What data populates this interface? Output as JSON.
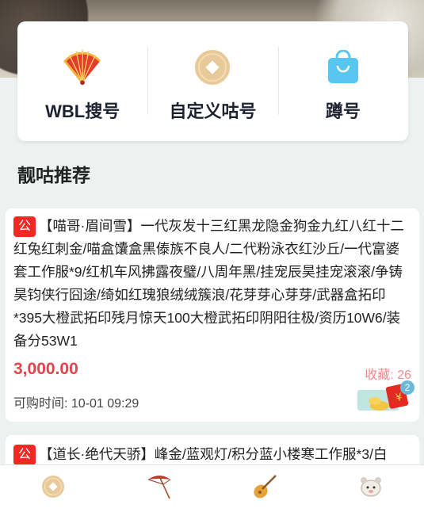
{
  "quick_actions": [
    {
      "label": "WBL搜号",
      "icon": "fan-icon"
    },
    {
      "label": "自定义咕号",
      "icon": "coin-icon"
    },
    {
      "label": "蹲号",
      "icon": "shopping-bag-icon"
    }
  ],
  "section_title": "靓咕推荐",
  "listings": [
    {
      "badge": "公",
      "description": "【喵哥·眉间雪】一代灰发十三红黑龙隐金狗金九红八红十二红兔红刺金/喵盒馕盒黑傣族不良人/二代粉泳衣红沙丘/一代富婆套工作服*9/红机车风拂露夜璧/八周年黑/挂宠辰昊挂宠滚滚/争铸昊钧侠行囧途/绮如红瑰狼绒绒簇浪/花芽芽心芽芽/武器盒拓印*395大橙武拓印残月惊天100大橙武拓印阴阳往极/资历10W6/装备分53W1",
      "price": "3,000.00",
      "favorites_label": "收藏: ",
      "favorites_count": "26",
      "available_label": "可购时间: ",
      "available_time": "10-01 09:29",
      "promo_badge": "2"
    },
    {
      "badge": "公",
      "description": "【道长·绝代天骄】峰金/蓝观灯/积分蓝小楼寒工作服*3/白"
    }
  ],
  "tabbar": [
    {
      "icon": "coin-icon"
    },
    {
      "icon": "umbrella-icon"
    },
    {
      "icon": "pipa-icon"
    },
    {
      "icon": "mascot-icon"
    }
  ],
  "colors": {
    "accent": "#e5434b",
    "badge": "#ee2b23",
    "coin": "#e8c99a",
    "bag": "#58c6f0"
  }
}
